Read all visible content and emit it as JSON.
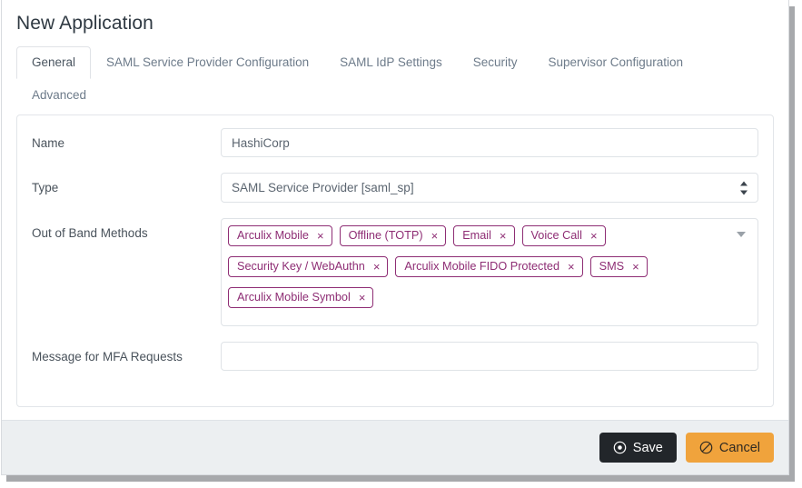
{
  "page": {
    "title": "New Application"
  },
  "tabs": [
    {
      "label": "General",
      "active": true
    },
    {
      "label": "SAML Service Provider Configuration",
      "active": false
    },
    {
      "label": "SAML IdP Settings",
      "active": false
    },
    {
      "label": "Security",
      "active": false
    },
    {
      "label": "Supervisor Configuration",
      "active": false
    },
    {
      "label": "Advanced",
      "active": false
    }
  ],
  "form": {
    "name": {
      "label": "Name",
      "value": "HashiCorp",
      "placeholder": "HashiCorp"
    },
    "type": {
      "label": "Type",
      "value": "SAML Service Provider [saml_sp]",
      "icon": "updown-chevron-icon"
    },
    "out_of_band": {
      "label": "Out of Band Methods",
      "caret_icon": "chevron-down-icon",
      "remove_glyph": "×",
      "tags": [
        "Arculix Mobile",
        "Offline (TOTP)",
        "Email",
        "Voice Call",
        "Security Key / WebAuthn",
        "Arculix Mobile FIDO Protected",
        "SMS",
        "Arculix Mobile Symbol"
      ]
    },
    "mfa_message": {
      "label": "Message for MFA Requests",
      "value": "",
      "placeholder": ""
    }
  },
  "footer": {
    "save_label": "Save",
    "save_icon": "record-circle-icon",
    "cancel_label": "Cancel",
    "cancel_icon": "ban-icon"
  },
  "colors": {
    "tag_purple": "#8e2d74",
    "save_dark": "#22262a",
    "cancel_orange": "#f0a33c",
    "footer_bg": "#eceff1",
    "border_gray": "#dfe3e7"
  }
}
